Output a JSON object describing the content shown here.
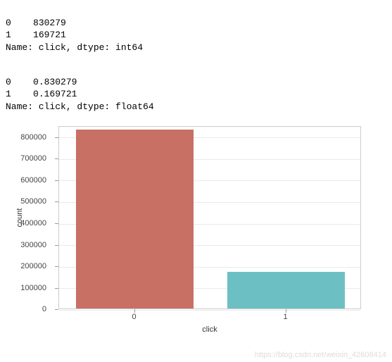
{
  "output_block1": {
    "rows": [
      {
        "index": "0",
        "value": "830279"
      },
      {
        "index": "1",
        "value": "169721"
      }
    ],
    "footer": "Name: click, dtype: int64"
  },
  "output_block2": {
    "rows": [
      {
        "index": "0",
        "value": "0.830279"
      },
      {
        "index": "1",
        "value": "0.169721"
      }
    ],
    "footer": "Name: click, dtype: float64"
  },
  "chart_data": {
    "type": "bar",
    "categories": [
      "0",
      "1"
    ],
    "values": [
      830279,
      169721
    ],
    "series": [
      {
        "name": "0",
        "value": 830279,
        "color": "#c87064"
      },
      {
        "name": "1",
        "value": 169721,
        "color": "#6cc0c4"
      }
    ],
    "xlabel": "click",
    "ylabel": "count",
    "ylim": [
      0,
      850000
    ],
    "yticks": [
      0,
      100000,
      200000,
      300000,
      400000,
      500000,
      600000,
      700000,
      800000
    ],
    "title": ""
  },
  "watermark": "https://blog.csdn.net/weixin_42608414"
}
